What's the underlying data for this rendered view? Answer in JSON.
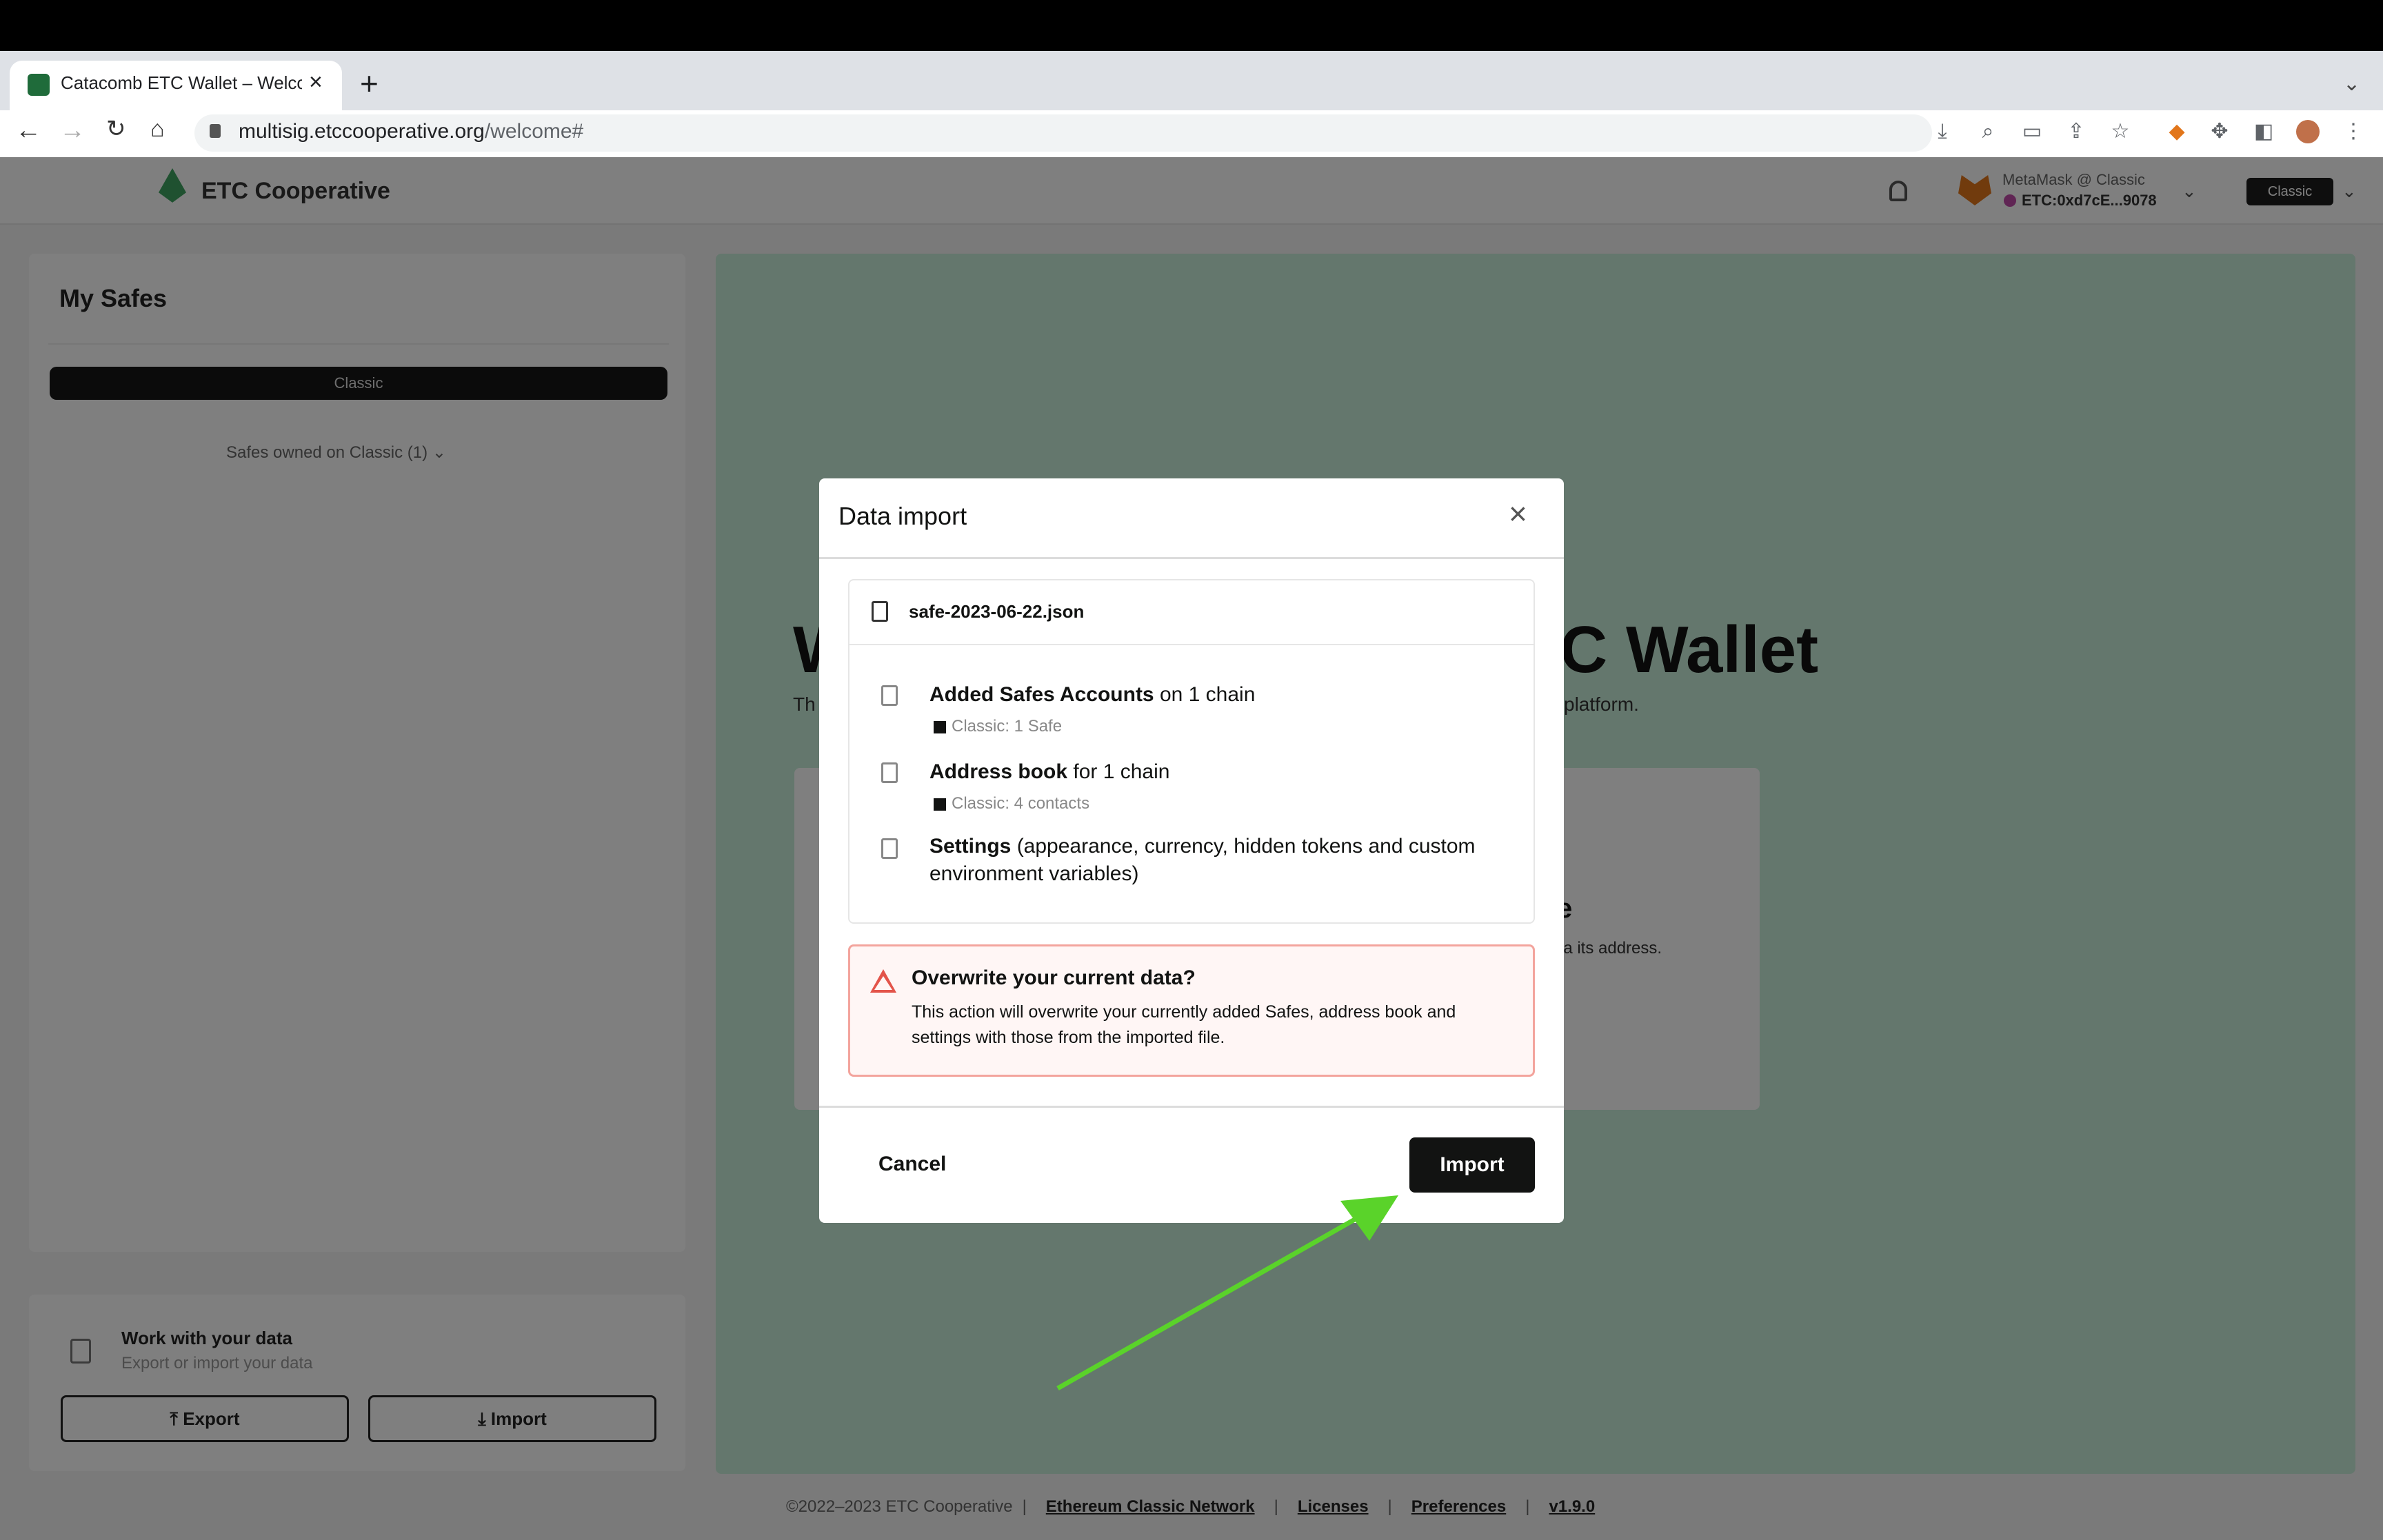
{
  "browser": {
    "tab_title": "Catacomb ETC Wallet – Welcome",
    "url_host": "multisig.etccooperative.org",
    "url_path": "/welcome#"
  },
  "header": {
    "brand": "ETC Cooperative",
    "wallet_label": "MetaMask @ Classic",
    "wallet_address": "ETC:0xd7cE...9078",
    "chain": "Classic"
  },
  "sidebar": {
    "title": "My Safes",
    "chain": "Classic",
    "safes_owned": "Safes owned on Classic (1)"
  },
  "data_card": {
    "title": "Work with your data",
    "subtitle": "Export or import your data",
    "export_label": "Export",
    "import_label": "Import"
  },
  "hero": {
    "title_left": "W",
    "title_right": "C Wallet",
    "subtitle_left": "Th",
    "subtitle_right": "platform.",
    "card_title_tail": "e",
    "card_sub_tail": "ia its address."
  },
  "footer": {
    "copyright": "©2022–2023 ETC Cooperative",
    "links": [
      "Ethereum Classic Network",
      "Licenses",
      "Preferences"
    ],
    "version": "v1.9.0"
  },
  "dialog": {
    "title": "Data import",
    "file_name": "safe-2023-06-22.json",
    "rows": [
      {
        "strong": "Added Safes Accounts",
        "rest": " on 1 chain",
        "sub": "Classic: 1 Safe"
      },
      {
        "strong": "Address book",
        "rest": " for 1 chain",
        "sub": "Classic: 4 contacts"
      },
      {
        "strong": "Settings",
        "rest": " (appearance, currency, hidden tokens and custom environment variables)",
        "sub": ""
      }
    ],
    "warning_title": "Overwrite your current data?",
    "warning_text": "This action will overwrite your currently added Safes, address book and settings with those from the imported file.",
    "cancel_label": "Cancel",
    "import_label": "Import"
  },
  "colors": {
    "accent": "#121312",
    "hero": "#c9eedb",
    "warning_border": "#f3a49d",
    "annotation_arrow": "#5ad32a"
  }
}
